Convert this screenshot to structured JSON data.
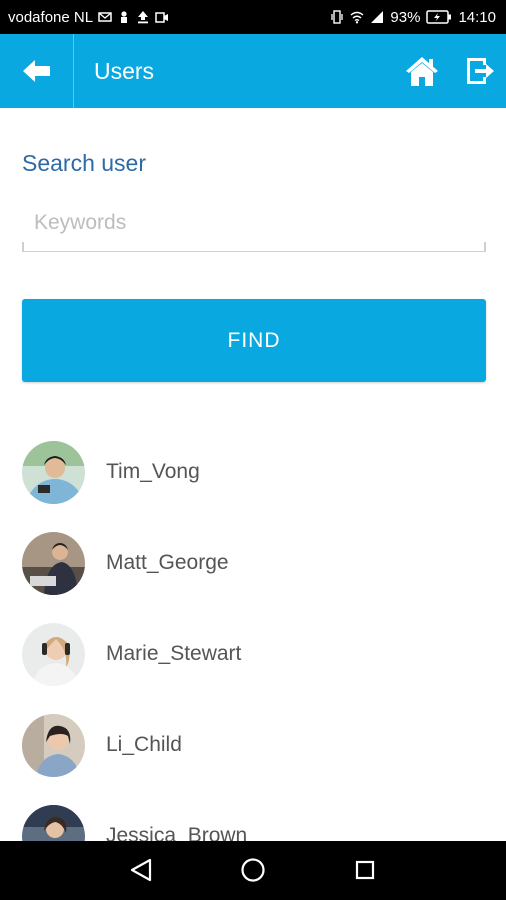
{
  "status_bar": {
    "carrier": "vodafone NL",
    "battery": "93%",
    "time": "14:10",
    "icons": [
      "mail-icon",
      "person-icon",
      "upload-icon",
      "voicemail-icon",
      "vibrate-icon",
      "wifi-icon",
      "signal-icon",
      "battery-charging-icon"
    ]
  },
  "appbar": {
    "title": "Users",
    "icons": [
      "back-arrow-icon",
      "home-icon",
      "logout-icon"
    ]
  },
  "search": {
    "label": "Search user",
    "placeholder": "Keywords",
    "value": ""
  },
  "find_button": {
    "label": "FIND"
  },
  "users": [
    {
      "name": "Tim_Vong"
    },
    {
      "name": "Matt_George"
    },
    {
      "name": "Marie_Stewart"
    },
    {
      "name": "Li_Child"
    },
    {
      "name": "Jessica_Brown"
    }
  ],
  "nav_bar": {
    "icons": [
      "back-triangle-icon",
      "home-circle-icon",
      "recents-square-icon"
    ]
  },
  "colors": {
    "primary": "#0aa8e0",
    "label_blue": "#2e6aa8",
    "text_gray": "#555555"
  }
}
